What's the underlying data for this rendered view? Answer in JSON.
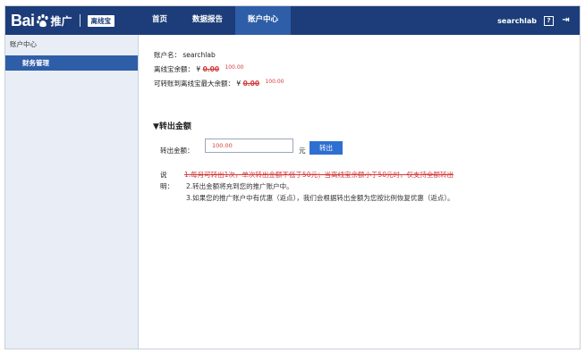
{
  "header": {
    "logo_text": "Bai",
    "logo_suffix": "推广",
    "logo_badge": "离线宝",
    "nav": [
      {
        "label": "首页",
        "active": false
      },
      {
        "label": "数据报告",
        "active": false
      },
      {
        "label": "账户中心",
        "active": true
      }
    ],
    "username": "searchlab",
    "help_glyph": "?",
    "logout_glyph": "⇥",
    "colors": {
      "topbar": "#1c3d79",
      "active": "#2f5ea8"
    }
  },
  "sidebar": {
    "title": "账户中心",
    "items": [
      {
        "label": "财务管理",
        "active": true
      }
    ]
  },
  "account": {
    "name_label": "账户名：",
    "name_value": "searchlab",
    "balance_label": "离线宝余额：",
    "balance_prefix": "¥",
    "balance_value": "0.00",
    "balance_note": "100.00",
    "max_label": "可转账到离线宝最大余额：",
    "max_prefix": "¥",
    "max_value": "0.00",
    "max_note": "100.00"
  },
  "transfer": {
    "section_title": "▼转出金额",
    "amount_label": "转出金额：",
    "amount_value": "100.00",
    "unit": "元",
    "button_label": "转出"
  },
  "notes": {
    "label": "说明：",
    "items": [
      "1.每月可转出1次，单次转出金额不低于50元；当离线宝余额小于50元时，仅支持全额转出",
      "2.转出金额将充到您的推广账户中。",
      "3.如果您的推广账户中有优惠（返点），我们会根据转出金额为您按比例恢复优惠（返点）。"
    ]
  }
}
